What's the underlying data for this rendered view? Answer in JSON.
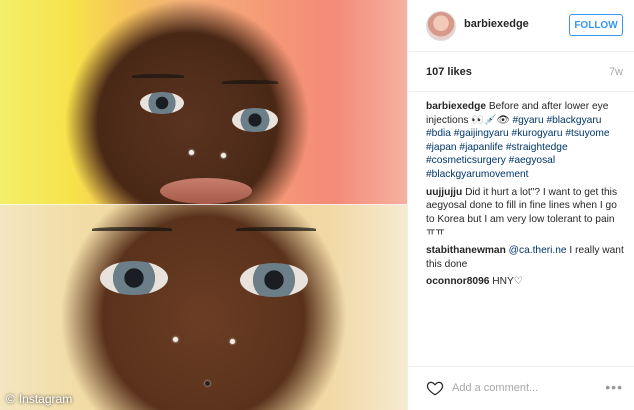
{
  "watermark": {
    "text": "Instagram"
  },
  "post": {
    "username": "barbiexedge",
    "follow_label": "FOLLOW",
    "likes": "107 likes",
    "time_ago": "7w"
  },
  "caption": {
    "author": "barbiexedge",
    "text_before": "Before and after lower eye injections ",
    "emoji": "👀💉👁",
    "hashtags": "#gyaru #blackgyaru #bdia #gaijingyaru #kurogyaru #tsuyome #japan #japanlife #straightedge #cosmeticsurgery #aegyosal #blackgyarumovement"
  },
  "comments": [
    {
      "author": "uujjujju",
      "text": "Did it hurt a lot\"? I want to get this aegyosal done to fill in fine lines when I go to Korea but I am very low tolerant to pain ㅠㅠ"
    },
    {
      "author": "stabithanewman",
      "mention": "@ca.theri.ne",
      "text": " I really want this done"
    },
    {
      "author": "oconnor8096",
      "text": "HNY♡"
    }
  ],
  "footer": {
    "add_comment_placeholder": "Add a comment...",
    "more_label": "•••"
  },
  "colors": {
    "accent": "#3897f0",
    "hashtag": "#003569"
  }
}
